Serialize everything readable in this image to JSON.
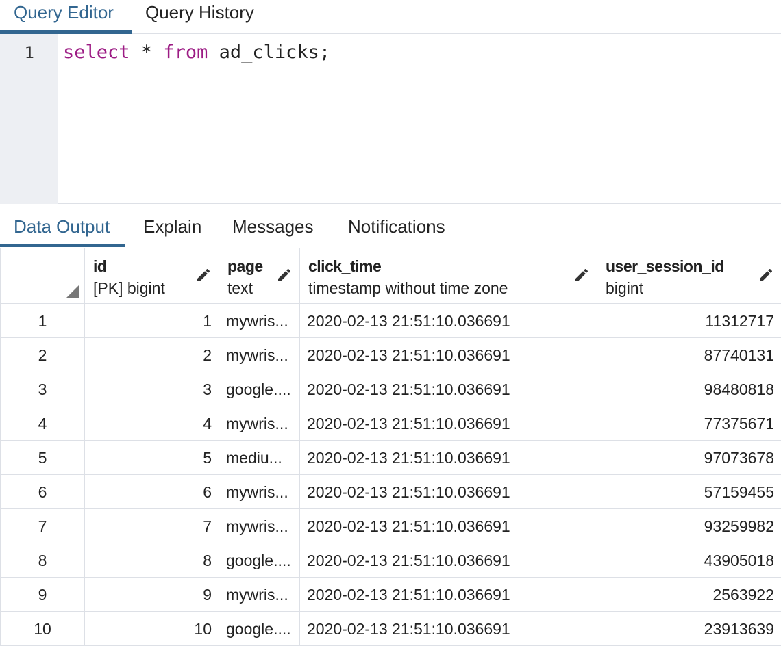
{
  "editor_tabs": [
    {
      "label": "Query Editor",
      "active": true
    },
    {
      "label": "Query History",
      "active": false
    }
  ],
  "editor": {
    "line_number": "1",
    "keyword_select": "select",
    "star": " * ",
    "keyword_from": "from",
    "rest": " ad_clicks;"
  },
  "output_tabs": [
    {
      "label": "Data Output",
      "active": true
    },
    {
      "label": "Explain",
      "active": false
    },
    {
      "label": "Messages",
      "active": false
    },
    {
      "label": "Notifications",
      "active": false
    }
  ],
  "columns": [
    {
      "name": "id",
      "type": "[PK] bigint"
    },
    {
      "name": "page",
      "type": "text"
    },
    {
      "name": "click_time",
      "type": "timestamp without time zone"
    },
    {
      "name": "user_session_id",
      "type": "bigint"
    }
  ],
  "rows": [
    {
      "n": "1",
      "id": "1",
      "page": "mywris...",
      "click_time": "2020-02-13 21:51:10.036691",
      "user_session_id": "11312717"
    },
    {
      "n": "2",
      "id": "2",
      "page": "mywris...",
      "click_time": "2020-02-13 21:51:10.036691",
      "user_session_id": "87740131"
    },
    {
      "n": "3",
      "id": "3",
      "page": "google....",
      "click_time": "2020-02-13 21:51:10.036691",
      "user_session_id": "98480818"
    },
    {
      "n": "4",
      "id": "4",
      "page": "mywris...",
      "click_time": "2020-02-13 21:51:10.036691",
      "user_session_id": "77375671"
    },
    {
      "n": "5",
      "id": "5",
      "page": "mediu...",
      "click_time": "2020-02-13 21:51:10.036691",
      "user_session_id": "97073678"
    },
    {
      "n": "6",
      "id": "6",
      "page": "mywris...",
      "click_time": "2020-02-13 21:51:10.036691",
      "user_session_id": "57159455"
    },
    {
      "n": "7",
      "id": "7",
      "page": "mywris...",
      "click_time": "2020-02-13 21:51:10.036691",
      "user_session_id": "93259982"
    },
    {
      "n": "8",
      "id": "8",
      "page": "google....",
      "click_time": "2020-02-13 21:51:10.036691",
      "user_session_id": "43905018"
    },
    {
      "n": "9",
      "id": "9",
      "page": "mywris...",
      "click_time": "2020-02-13 21:51:10.036691",
      "user_session_id": "2563922"
    },
    {
      "n": "10",
      "id": "10",
      "page": "google....",
      "click_time": "2020-02-13 21:51:10.036691",
      "user_session_id": "23913639"
    }
  ],
  "icons": {
    "edit": "pencil-icon",
    "corner": "sort-corner-icon"
  },
  "colors": {
    "accent": "#326690",
    "keyword": "#9c1b84",
    "gutter": "#edeff3",
    "border": "#dde0e6"
  }
}
